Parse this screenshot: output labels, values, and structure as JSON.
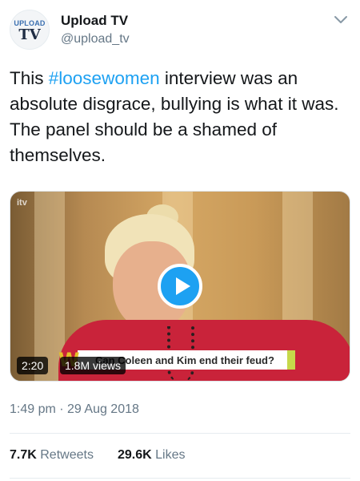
{
  "account": {
    "name": "Upload TV",
    "handle": "@upload_tv",
    "avatar_logo_top": "UPLOAD",
    "avatar_logo_bottom": "TV"
  },
  "tweet": {
    "text_before": "This ",
    "hashtag": "#loosewomen",
    "text_after": " interview was an absolute disgrace, bullying is what it was. The panel should be a shamed of themselves."
  },
  "media": {
    "broadcaster_logo": "itv",
    "banner_letter": "W",
    "banner_text": "Can Coleen and Kim end their feud?",
    "duration": "2:20",
    "views": "1.8M views",
    "play_icon": "play-icon"
  },
  "meta": {
    "timestamp": "1:49 pm · 29 Aug 2018"
  },
  "stats": {
    "retweets_count": "7.7K",
    "retweets_label": "Retweets",
    "likes_count": "29.6K",
    "likes_label": "Likes"
  },
  "colors": {
    "accent": "#1da1f2",
    "secondary_text": "#657786",
    "primary_text": "#14171a"
  }
}
